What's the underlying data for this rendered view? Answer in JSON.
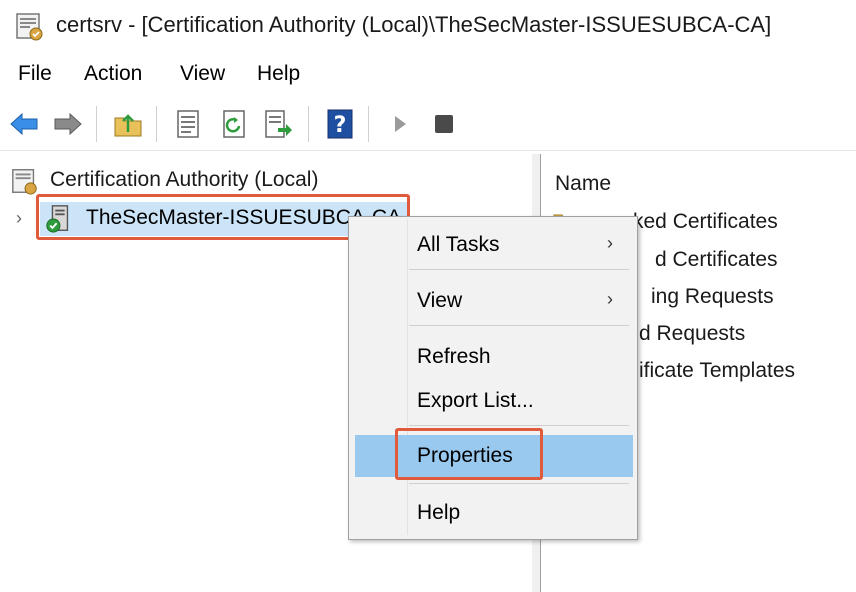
{
  "window": {
    "title": "certsrv - [Certification Authority (Local)\\TheSecMaster-ISSUESUBCA-CA]"
  },
  "menubar": {
    "items": [
      "File",
      "Action",
      "View",
      "Help"
    ]
  },
  "toolbar": {
    "buttons": [
      "back-arrow-icon",
      "forward-arrow-icon",
      "up-folder-icon",
      "properties-sheet-icon",
      "refresh-icon",
      "export-list-icon",
      "help-icon",
      "start-service-icon",
      "stop-service-icon"
    ]
  },
  "tree": {
    "root_label": "Certification Authority (Local)",
    "node_label": "TheSecMaster-ISSUESUBCA-CA"
  },
  "list": {
    "header": "Name",
    "items": [
      "Revoked Certificates",
      "Issued Certificates",
      "Pending Requests",
      "Failed Requests",
      "Certificate Templates"
    ],
    "visible_text": [
      "ked Certificates",
      "d Certificates",
      "ing Requests",
      "d Requests",
      "ificate Templates"
    ]
  },
  "context_menu": {
    "all_tasks": "All Tasks",
    "view": "View",
    "refresh": "Refresh",
    "export_list": "Export List...",
    "properties": "Properties",
    "help": "Help",
    "submenu_arrow": "›"
  },
  "colors": {
    "highlight_border": "#e05a3c",
    "selected_row": "#cce4f7",
    "menu_hover": "#99c9ef"
  }
}
